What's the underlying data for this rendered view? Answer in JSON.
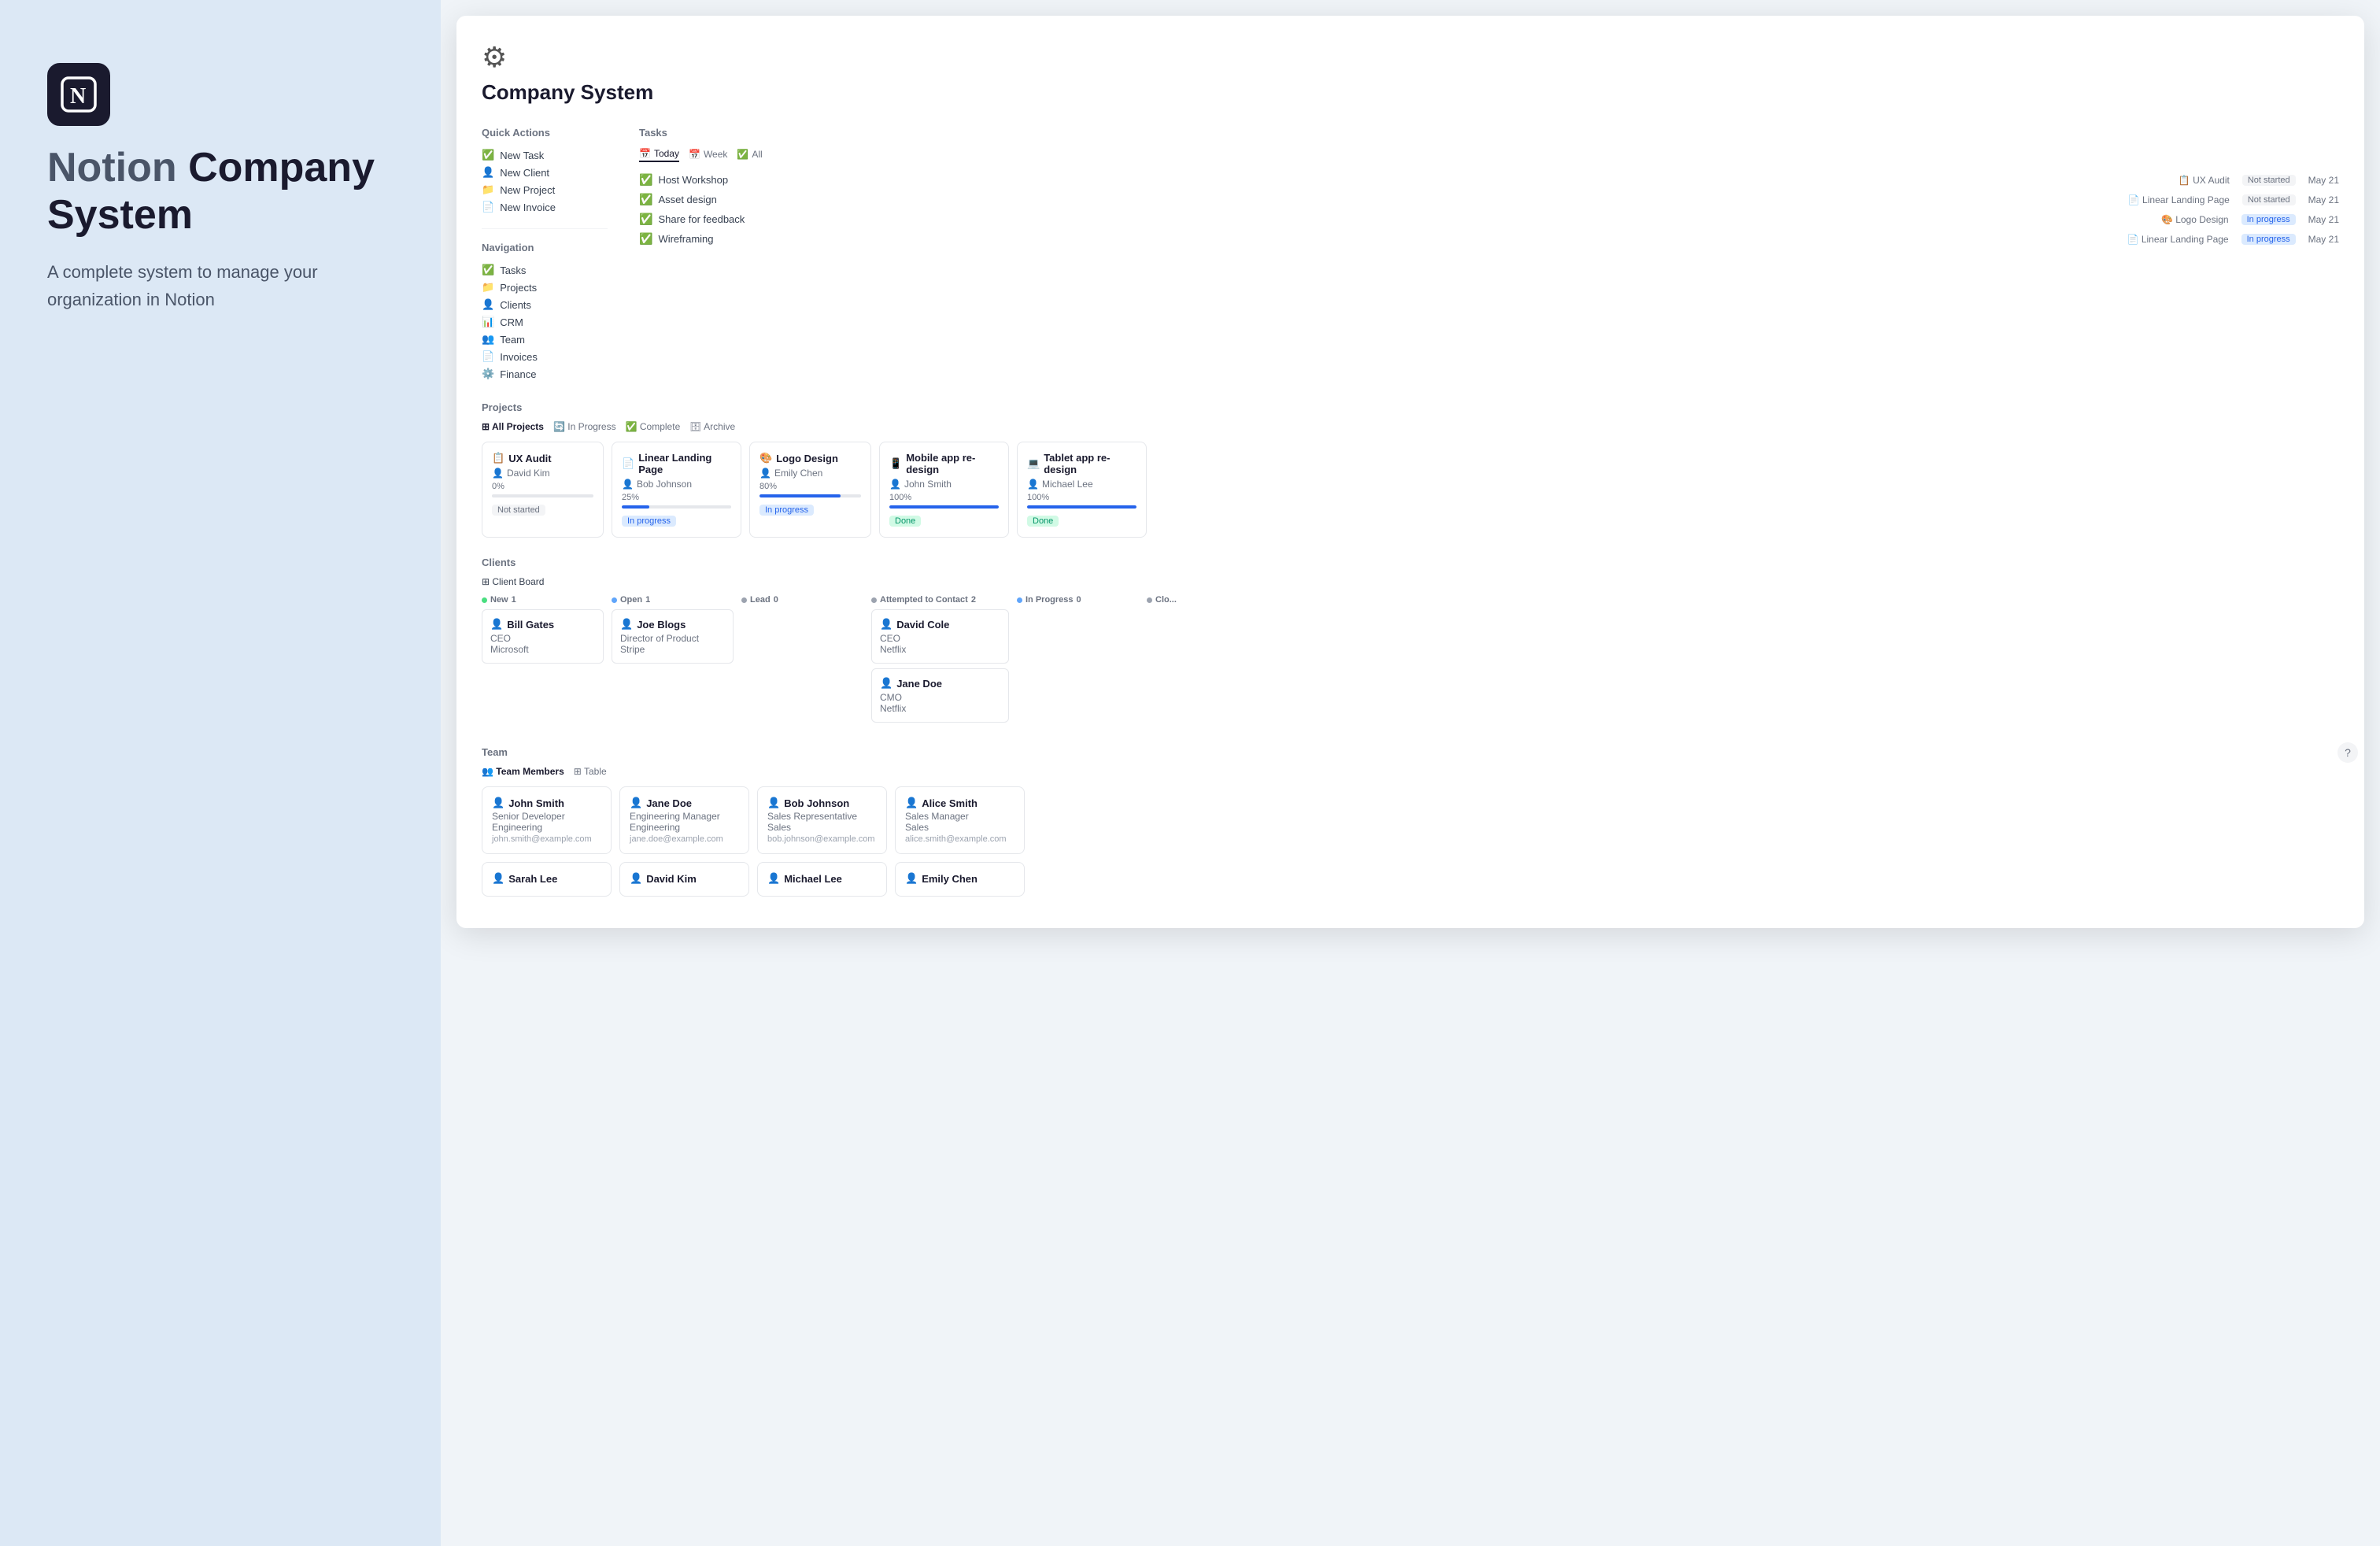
{
  "left": {
    "logo_text": "N",
    "hero_title_light": "Notion",
    "hero_title_bold": "Company System",
    "subtitle": "A complete system to manage your organization in Notion"
  },
  "notion_page": {
    "title": "Company System",
    "quick_actions": {
      "label": "Quick Actions",
      "items": [
        {
          "icon": "✅",
          "label": "New Task"
        },
        {
          "icon": "👤",
          "label": "New Client"
        },
        {
          "icon": "📁",
          "label": "New Project"
        },
        {
          "icon": "📄",
          "label": "New Invoice"
        }
      ]
    },
    "navigation": {
      "label": "Navigation",
      "items": [
        {
          "icon": "✅",
          "label": "Tasks"
        },
        {
          "icon": "📁",
          "label": "Projects"
        },
        {
          "icon": "👤",
          "label": "Clients"
        },
        {
          "icon": "📊",
          "label": "CRM"
        },
        {
          "icon": "👥",
          "label": "Team"
        },
        {
          "icon": "📄",
          "label": "Invoices"
        },
        {
          "icon": "⚙️",
          "label": "Finance"
        }
      ]
    },
    "tasks": {
      "label": "Tasks",
      "tabs": [
        {
          "label": "Today",
          "icon": "📅",
          "active": true
        },
        {
          "label": "Week",
          "icon": "📅",
          "active": false
        },
        {
          "label": "All",
          "icon": "✅",
          "active": false
        }
      ],
      "items": [
        {
          "label": "Host Workshop",
          "project": "UX Audit",
          "status": "Not started",
          "date": "May 21"
        },
        {
          "label": "Asset design",
          "project": "Linear Landing Page",
          "status": "Not started",
          "date": "May 21"
        },
        {
          "label": "Share for feedback",
          "project": "Logo Design",
          "status": "In progress",
          "date": "May 21"
        },
        {
          "label": "Wireframing",
          "project": "Linear Landing Page",
          "status": "In progress",
          "date": "May 21"
        }
      ]
    },
    "projects": {
      "label": "Projects",
      "tabs": [
        {
          "label": "All Projects",
          "active": true
        },
        {
          "label": "In Progress",
          "active": false
        },
        {
          "label": "Complete",
          "active": false
        },
        {
          "label": "Archive",
          "active": false
        }
      ],
      "cards": [
        {
          "icon": "📋",
          "title": "UX Audit",
          "person": "David Kim",
          "pct": "0%",
          "progress": 0,
          "status": "Not started",
          "status_type": "not-started"
        },
        {
          "icon": "📄",
          "title": "Linear Landing Page",
          "person": "Bob Johnson",
          "pct": "25%",
          "progress": 25,
          "status": "In progress",
          "status_type": "in-progress"
        },
        {
          "icon": "🎨",
          "title": "Logo Design",
          "person": "Emily Chen",
          "pct": "80%",
          "progress": 80,
          "status": "In progress",
          "status_type": "in-progress"
        },
        {
          "icon": "📱",
          "title": "Mobile app re-design",
          "person": "John Smith",
          "pct": "100%",
          "progress": 100,
          "status": "Done",
          "status_type": "done"
        },
        {
          "icon": "💻",
          "title": "Tablet app re-design",
          "person": "Michael Lee",
          "pct": "100%",
          "progress": 100,
          "status": "Done",
          "status_type": "done"
        }
      ]
    },
    "clients": {
      "label": "Clients",
      "tab": "Client Board",
      "columns": [
        {
          "label": "New",
          "count": "1",
          "dot": "green",
          "cards": [
            {
              "name": "Bill Gates",
              "role": "CEO",
              "company": "Microsoft"
            }
          ]
        },
        {
          "label": "Open",
          "count": "1",
          "dot": "blue",
          "cards": [
            {
              "name": "Joe Blogs",
              "role": "Director of Product",
              "company": "Stripe"
            }
          ]
        },
        {
          "label": "Lead",
          "count": "0",
          "dot": "gray",
          "cards": []
        },
        {
          "label": "Attempted to Contact",
          "count": "2",
          "dot": "gray",
          "cards": [
            {
              "name": "David Cole",
              "role": "CEO",
              "company": "Netflix"
            },
            {
              "name": "Jane Doe",
              "role": "CMO",
              "company": "Netflix"
            }
          ]
        },
        {
          "label": "In Progress",
          "count": "0",
          "dot": "blue",
          "cards": []
        },
        {
          "label": "Clo...",
          "count": "",
          "dot": "gray",
          "cards": []
        }
      ]
    },
    "team": {
      "label": "Team",
      "tabs": [
        {
          "label": "Team Members",
          "active": true
        },
        {
          "label": "Table",
          "active": false
        }
      ],
      "cards": [
        {
          "name": "John Smith",
          "role": "Senior Developer",
          "dept": "Engineering",
          "email": "john.smith@example.com"
        },
        {
          "name": "Jane Doe",
          "role": "Engineering Manager",
          "dept": "Engineering",
          "email": "jane.doe@example.com"
        },
        {
          "name": "Bob Johnson",
          "role": "Sales Representative",
          "dept": "Sales",
          "email": "bob.johnson@example.com"
        },
        {
          "name": "Alice Smith",
          "role": "Sales Manager",
          "dept": "Sales",
          "email": "alice.smith@example.com"
        }
      ],
      "extra_cards": [
        {
          "name": "Sarah Lee",
          "role": "",
          "dept": "",
          "email": ""
        },
        {
          "name": "David Kim",
          "role": "",
          "dept": "",
          "email": ""
        },
        {
          "name": "Michael Lee",
          "role": "",
          "dept": "",
          "email": ""
        },
        {
          "name": "Emily Chen",
          "role": "",
          "dept": "",
          "email": ""
        }
      ]
    }
  }
}
